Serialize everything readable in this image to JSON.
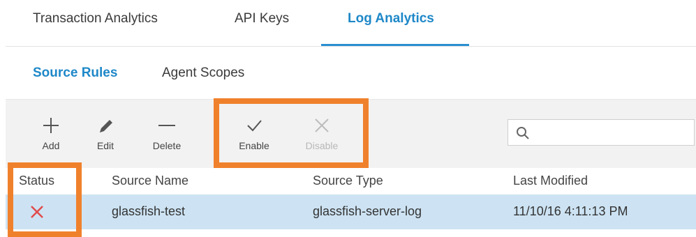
{
  "top_tabs": [
    {
      "label": "Transaction Analytics",
      "active": false
    },
    {
      "label": "API Keys",
      "active": false
    },
    {
      "label": "Log Analytics",
      "active": true
    }
  ],
  "sub_tabs": [
    {
      "label": "Source Rules",
      "active": true
    },
    {
      "label": "Agent Scopes",
      "active": false
    }
  ],
  "toolbar": {
    "add_label": "Add",
    "edit_label": "Edit",
    "delete_label": "Delete",
    "enable_label": "Enable",
    "disable_label": "Disable"
  },
  "search": {
    "placeholder": "",
    "value": ""
  },
  "table": {
    "columns": [
      "Status",
      "Source Name",
      "Source Type",
      "Last Modified"
    ],
    "rows": [
      {
        "status": "disabled",
        "source_name": "glassfish-test",
        "source_type": "glassfish-server-log",
        "last_modified": "11/10/16 4:11:13 PM",
        "selected": true
      }
    ]
  },
  "colors": {
    "accent": "#1e88c8",
    "highlight": "#f0812c",
    "selected_row": "#cde3f3",
    "status_disabled": "#e14b4b"
  },
  "icons": {
    "add": "plus-icon",
    "edit": "pencil-icon",
    "delete": "minus-icon",
    "enable": "check-icon",
    "disable": "x-icon",
    "search": "search-icon",
    "status": "x-icon"
  }
}
